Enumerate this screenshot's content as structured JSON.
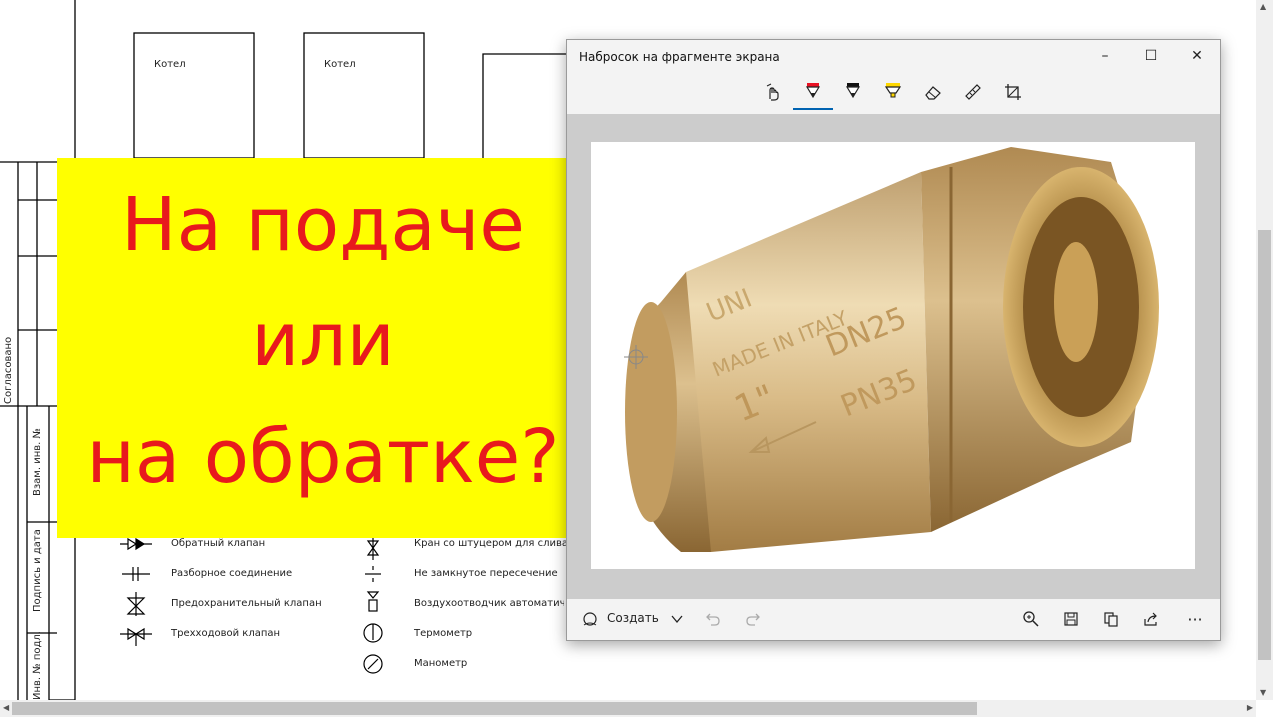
{
  "drawing": {
    "boilers": [
      "Котел",
      "Котел"
    ],
    "stamp_labels": [
      "Согласовано",
      "Взам. инв. №",
      "Подпись и дата",
      "Инв. № подл."
    ],
    "legend_left": [
      "Обратный клапан",
      "Разборное соединение",
      "Предохранительный клапан",
      "Трехходовой клапан"
    ],
    "legend_right": [
      "Кран со штуцером для слива",
      "Не замкнутое пересечение",
      "Воздухоотводчик автоматический",
      "Термометр",
      "Манометр"
    ]
  },
  "banner": {
    "line1": "На подаче",
    "line2": "или",
    "line3": "на обратке?",
    "bg_color": "#ffff00",
    "text_color": "#e8191d"
  },
  "snip_window": {
    "title": "Набросок на фрагменте экрана",
    "min_label": "–",
    "max_label": "☐",
    "close_label": "✕",
    "tools": [
      "touch-writing-icon",
      "ballpoint-pen-icon",
      "pencil-icon",
      "highlighter-icon",
      "eraser-icon",
      "ruler-icon",
      "crop-icon"
    ],
    "create_label": "Создать",
    "more_label": "···",
    "image": {
      "marking_1": "DN25",
      "marking_2": "PN35",
      "marking_3": "MADE IN ITALY",
      "marking_4": "1\"",
      "marking_5": "UNI"
    }
  }
}
